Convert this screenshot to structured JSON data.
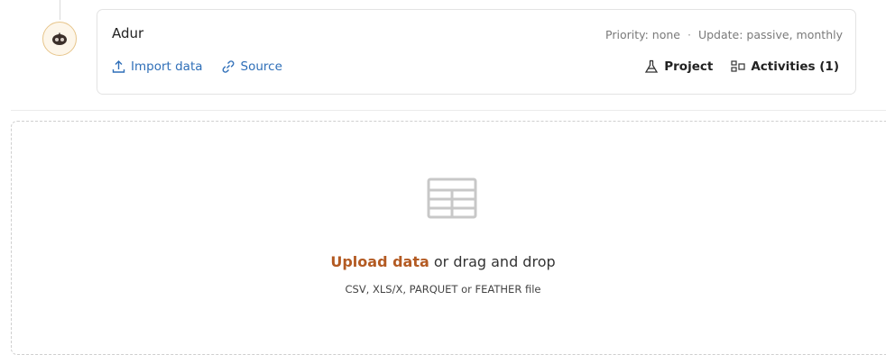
{
  "header": {
    "title": "Adur",
    "priority": "Priority: none",
    "separator": "·",
    "update": "Update: passive, monthly",
    "import_label": "Import data",
    "source_label": "Source",
    "project_label": "Project",
    "activities_label": "Activities (1)"
  },
  "avatar": {
    "icon": "robot-icon"
  },
  "dropzone": {
    "upload_link": "Upload data",
    "upload_rest": " or drag and drop",
    "formats": "CSV, XLS/X, PARQUET or FEATHER file",
    "icon": "table-icon"
  },
  "colors": {
    "link_blue": "#2f6fb8",
    "upload_orange": "#b35a22",
    "avatar_ring": "#e7c58b"
  }
}
